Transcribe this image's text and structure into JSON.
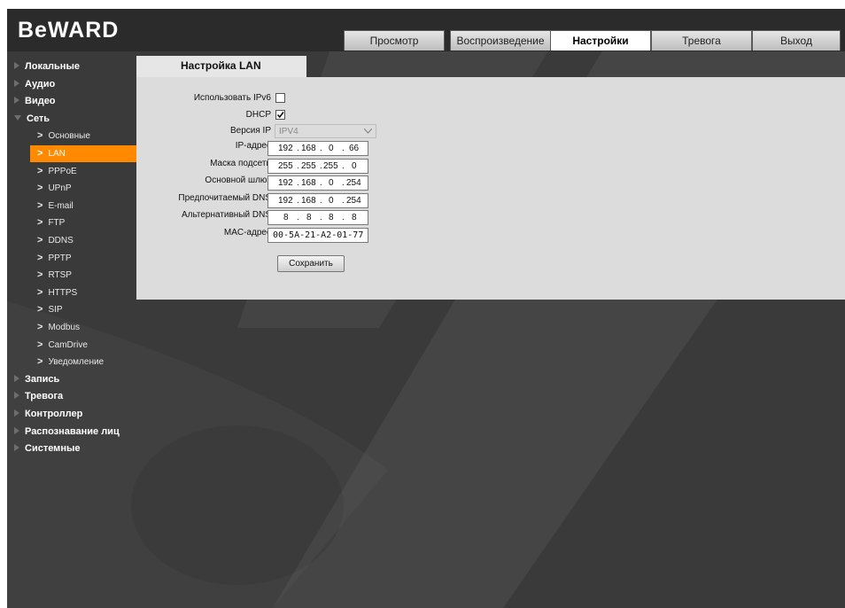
{
  "brand": {
    "logo_text": "BeWARD",
    "colors": {
      "accent": "#ff8a00",
      "header_bg": "#2b2b2b",
      "page_bg": "#3a3a3a",
      "panel_bg": "#dcdcdc"
    }
  },
  "tabs": [
    {
      "label": "Просмотр",
      "active": false
    },
    {
      "label": "Воспроизведение",
      "active": false
    },
    {
      "label": "Настройки",
      "active": true
    },
    {
      "label": "Тревога",
      "active": false
    },
    {
      "label": "Выход",
      "active": false
    }
  ],
  "sidebar": {
    "categories_top": [
      "Локальные",
      "Аудио",
      "Видео"
    ],
    "network": "Сеть",
    "network_items": [
      "Основные",
      "LAN",
      "PPPoE",
      "UPnP",
      "E-mail",
      "FTP",
      "DDNS",
      "PPTP",
      "RTSP",
      "HTTPS",
      "SIP",
      "Modbus",
      "CamDrive",
      "Уведомление"
    ],
    "active_item": "LAN",
    "categories_bottom": [
      "Запись",
      "Тревога",
      "Контроллер",
      "Распознавание лиц",
      "Системные"
    ]
  },
  "content": {
    "title": "Настройка LAN",
    "ipv6_label": "Использовать IPv6",
    "ipv6_checked": false,
    "dhcp_label": "DHCP",
    "dhcp_checked": true,
    "ipversion_label": "Версия IP",
    "ipversion_value": "IPV4",
    "ip_label": "IP-адрес",
    "ip": [
      "192",
      "168",
      "0",
      "66"
    ],
    "mask_label": "Маска подсети",
    "mask": [
      "255",
      "255",
      "255",
      "0"
    ],
    "gateway_label": "Основной шлюз",
    "gateway": [
      "192",
      "168",
      "0",
      "254"
    ],
    "dns1_label": "Предпочитаемый DNS",
    "dns1": [
      "192",
      "168",
      "0",
      "254"
    ],
    "dns2_label": "Альтернативный DNS",
    "dns2": [
      "8",
      "8",
      "8",
      "8"
    ],
    "mac_label": "MAC-адрес",
    "mac": "00-5A-21-A2-01-77",
    "save_label": "Сохранить"
  }
}
